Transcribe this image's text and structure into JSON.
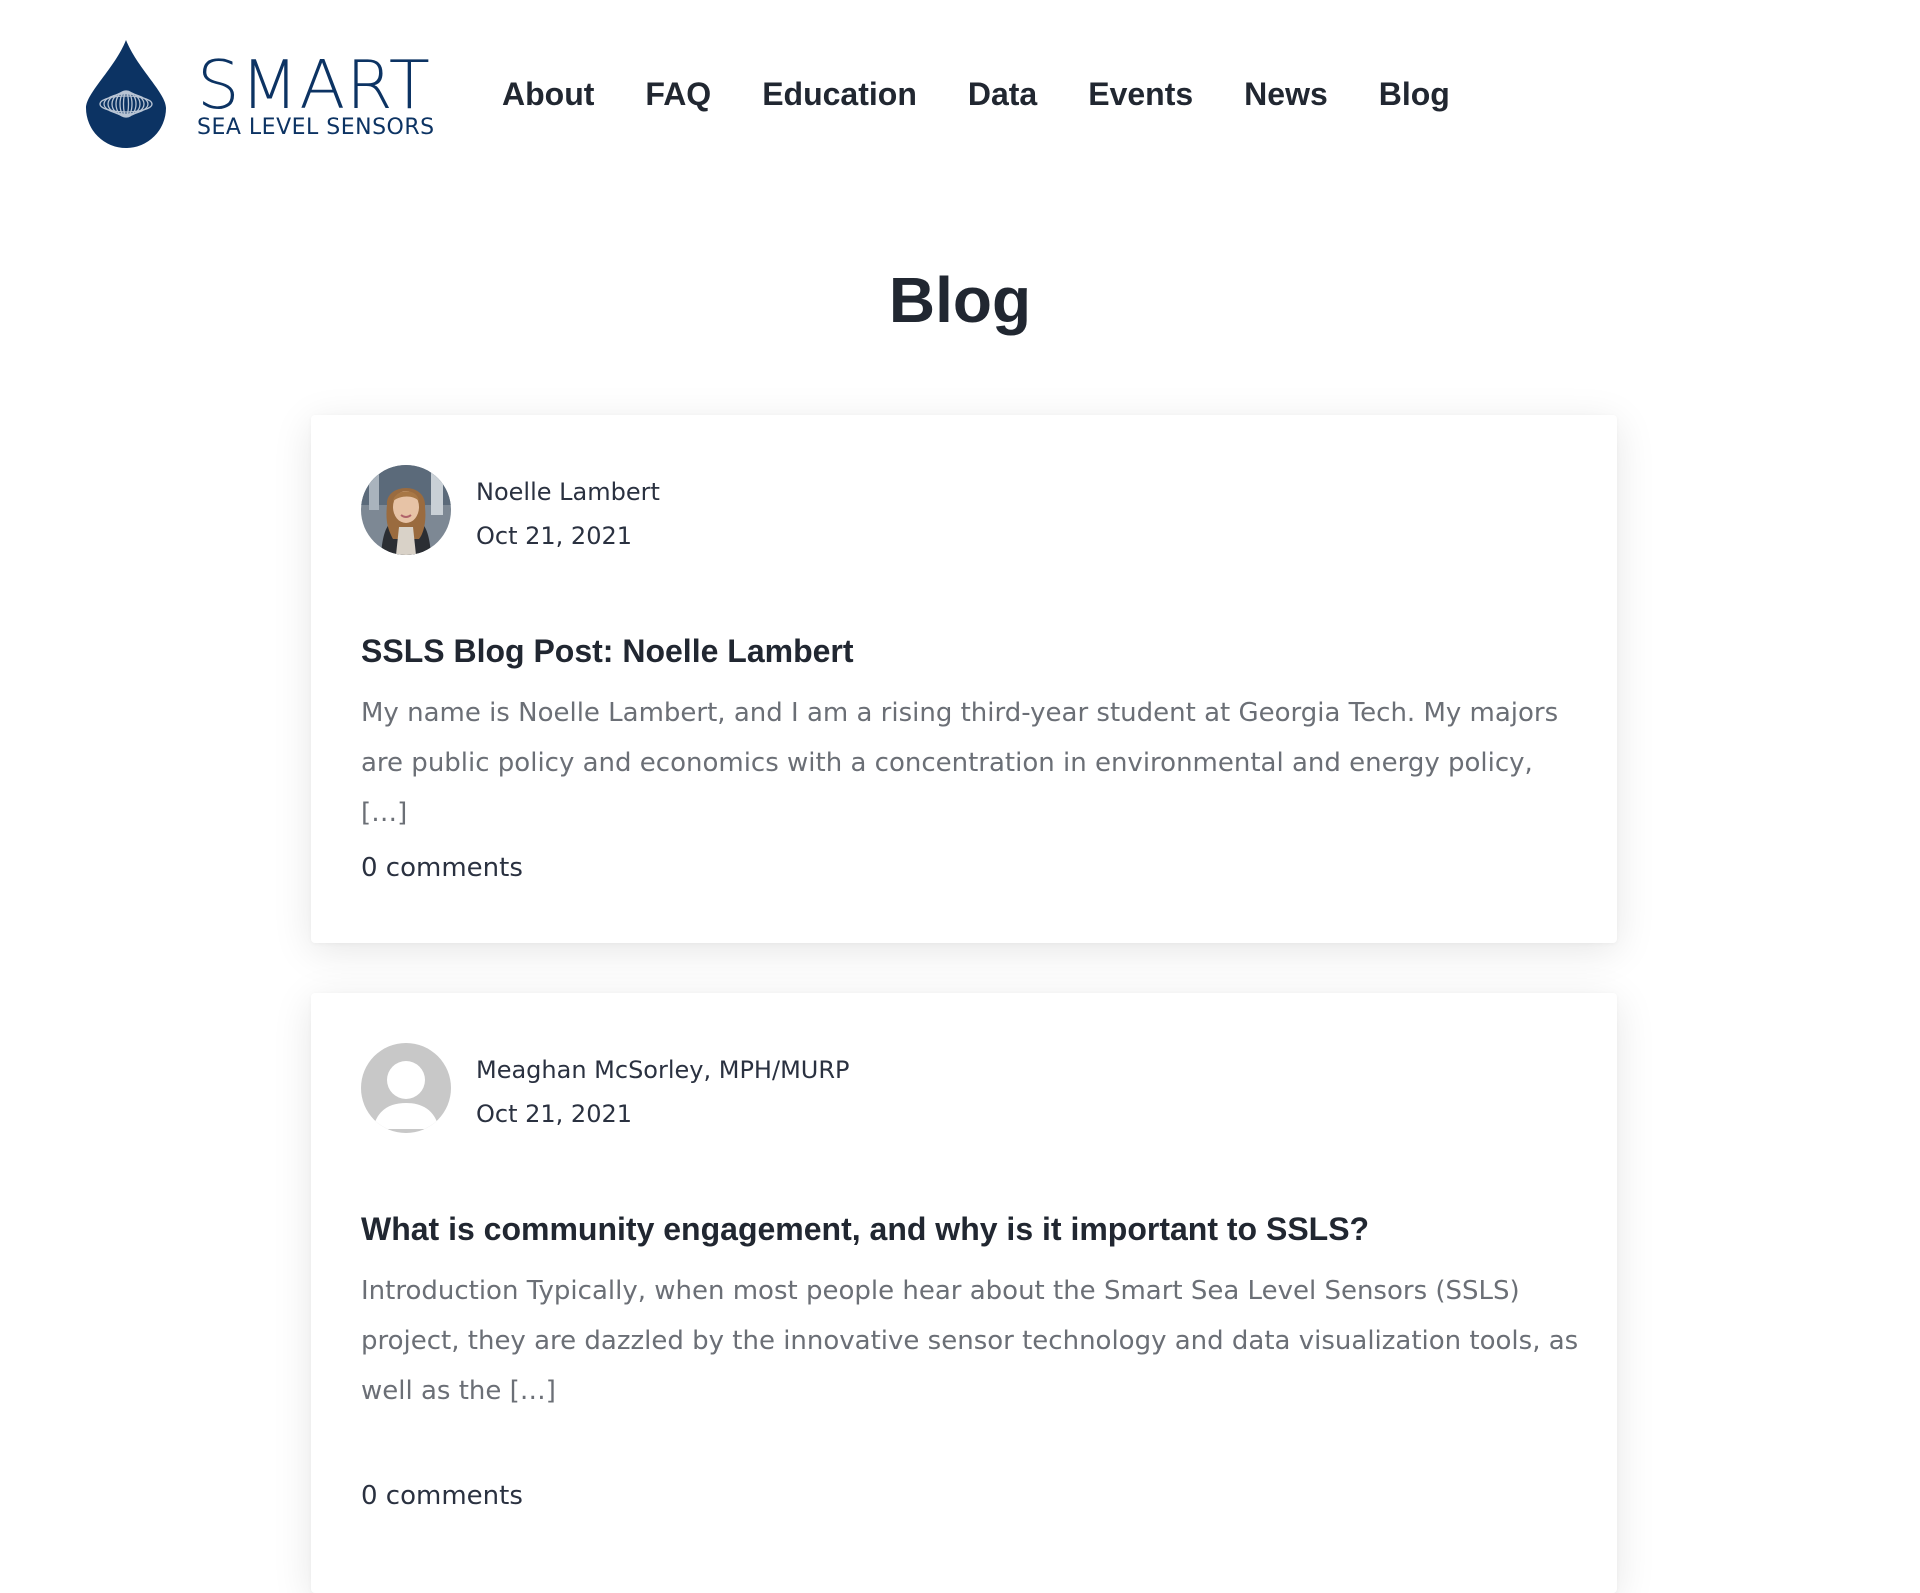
{
  "brand": {
    "name": "SMART",
    "tagline": "SEA LEVEL SENSORS",
    "color": "#0c3363"
  },
  "nav": {
    "items": [
      {
        "label": "About"
      },
      {
        "label": "FAQ"
      },
      {
        "label": "Education"
      },
      {
        "label": "Data"
      },
      {
        "label": "Events"
      },
      {
        "label": "News"
      },
      {
        "label": "Blog"
      }
    ]
  },
  "page": {
    "title": "Blog"
  },
  "posts": [
    {
      "author": "Noelle Lambert",
      "date": "Oct 21, 2021",
      "avatar": "author-photo",
      "title": "SSLS Blog Post: Noelle Lambert",
      "excerpt": "My name is Noelle Lambert, and I am a rising third-year student at Georgia Tech. My majors are public policy and economics with a concentration in environmental and energy policy, […]",
      "comments": "0 comments"
    },
    {
      "author": "Meaghan McSorley, MPH/MURP",
      "date": "Oct 21, 2021",
      "avatar": "default-user-icon",
      "title": "What is community engagement, and why is it important to SSLS?",
      "excerpt": "Introduction Typically, when most people hear about the Smart Sea Level Sensors (SSLS) project, they are dazzled by the innovative sensor technology and data visualization tools, as well as the […]",
      "comments": "0 comments"
    }
  ],
  "colors": {
    "text": "#212731",
    "excerpt": "#6b6f76",
    "avatar_placeholder": "#c8c8c8"
  }
}
